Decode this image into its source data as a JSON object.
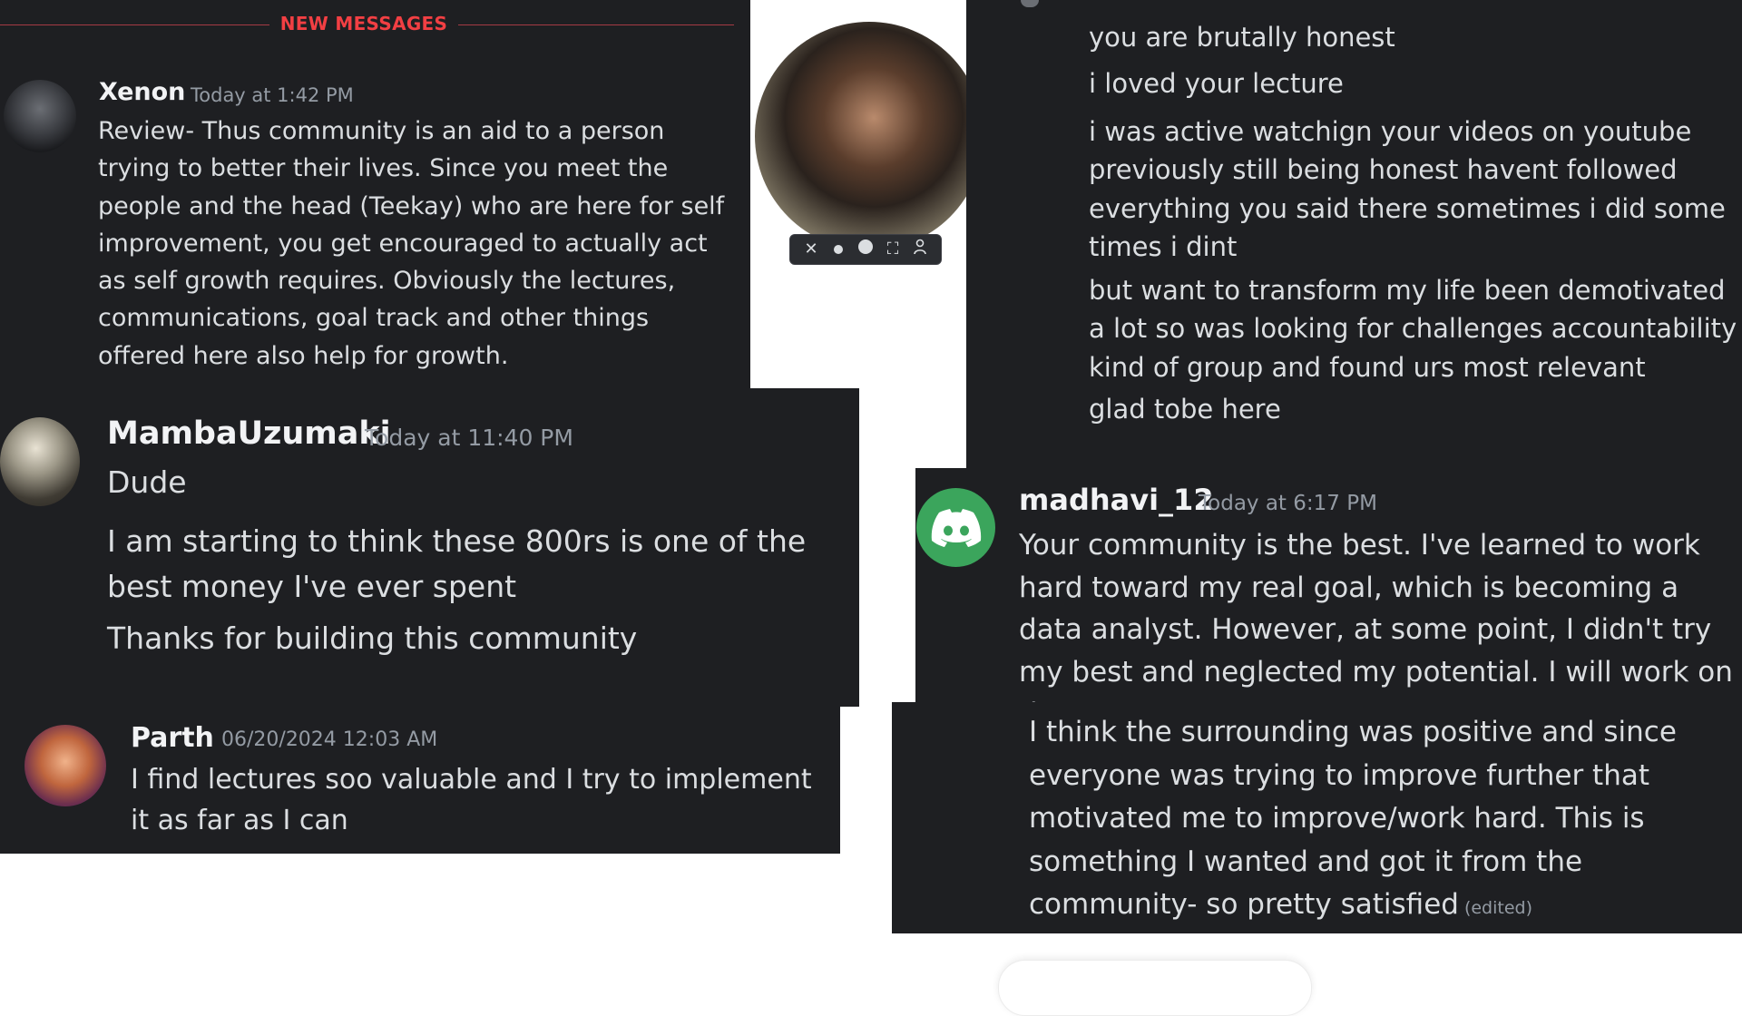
{
  "banner": {
    "label": "NEW MESSAGES",
    "color": "#f23f43"
  },
  "messages": {
    "xenon": {
      "author": "Xenon",
      "timestamp": "Today at 1:42 PM",
      "body": "Review- Thus community is an aid to a person trying to better their lives. Since you meet the people and the head (Teekay) who are here for self improvement, you get encouraged to actually act as self growth requires. Obviously the lectures, communications, goal track and other things offered here also help for growth."
    },
    "mamba": {
      "author": "MambaUzumaki",
      "timestamp": "Today at 11:40 PM",
      "lines": [
        "Dude",
        "I am starting to think these 800rs is one of the best money I've ever spent",
        "Thanks for building this community"
      ]
    },
    "parth": {
      "author": "Parth",
      "timestamp": "06/20/2024 12:03 AM",
      "body": "I find lectures soo valuable and I try to implement it as far as I can"
    },
    "right_top": {
      "lines": [
        "you are brutally honest",
        "i loved your lecture",
        "i was active watchign your videos on youtube previously still being honest havent followed everything you said there sometimes i did some times i dint",
        "but want to transform my life been demotivated a lot so was looking for challenges accountability kind of group and found urs most relevant",
        "glad tobe here"
      ]
    },
    "madhavi": {
      "author": "madhavi_12",
      "timestamp": "Today at 6:17 PM",
      "body": "Your community is the best. I've learned to work hard toward my real goal, which is becoming a data analyst. However, at some point, I didn't try my best and neglected my potential. I will work on that."
    },
    "continuation": {
      "body": "I think the surrounding was positive and since everyone was trying to improve further that motivated me to improve/work hard. This is something I wanted and got it from the community- so pretty satisfied",
      "edited_label": "(edited)"
    }
  },
  "webcam": {
    "controls": [
      "close-icon",
      "dot-small-icon",
      "dot-large-icon",
      "fullscreen-icon",
      "person-icon"
    ]
  },
  "colors": {
    "card_bg": "#1e1f22",
    "text": "#dbdee1",
    "timestamp": "#949ba4",
    "discord_avatar_green": "#3ba55c"
  }
}
